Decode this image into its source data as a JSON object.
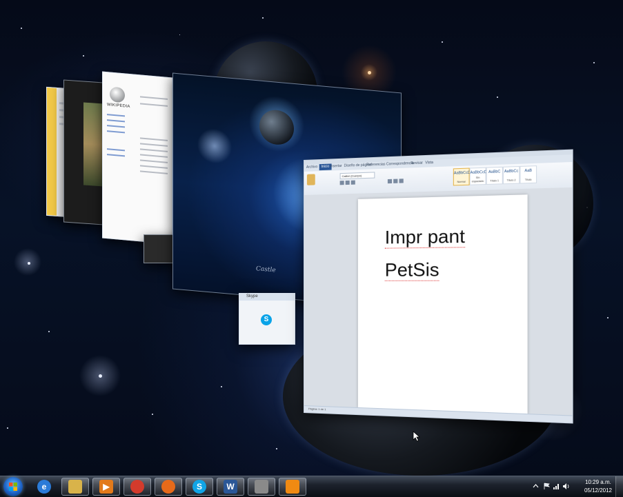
{
  "document": {
    "lines": [
      "Impr pant",
      "PetSis"
    ],
    "font_name": "Calibri (Cuerpo)",
    "tabs": [
      "Archivo",
      "Inicio",
      "Insertar",
      "Diseño de página",
      "Referencias",
      "Correspondencia",
      "Revisar",
      "Vista"
    ],
    "styles": [
      {
        "preview": "AaBbCcDc",
        "name": "Normal"
      },
      {
        "preview": "AaBbCcDc",
        "name": "Sin espaciado"
      },
      {
        "preview": "AaBbC",
        "name": "Título 1"
      },
      {
        "preview": "AaBbCc",
        "name": "Título 2"
      },
      {
        "preview": "AaB",
        "name": "Título"
      }
    ],
    "status": "Página: 1 de 1"
  },
  "wiki": {
    "title": "WIKIPEDIA"
  },
  "wallpaper": {
    "signature": "Castle"
  },
  "skype": {
    "title": "Skype"
  },
  "taskbar": {
    "items": [
      {
        "name": "internet-explorer",
        "glyph": "e",
        "color": "#2b7bd8",
        "active": false
      },
      {
        "name": "file-explorer",
        "glyph": "",
        "color": "#d9b34a",
        "active": true
      },
      {
        "name": "media-player",
        "glyph": "▶",
        "color": "#e27a1b",
        "active": true
      },
      {
        "name": "chrome",
        "glyph": "",
        "color": "#d33b2c",
        "active": true
      },
      {
        "name": "firefox",
        "glyph": "",
        "color": "#e66a1a",
        "active": true
      },
      {
        "name": "skype",
        "glyph": "S",
        "color": "#11a5e6",
        "active": true
      },
      {
        "name": "word",
        "glyph": "W",
        "color": "#2b5797",
        "active": true
      },
      {
        "name": "tool",
        "glyph": "",
        "color": "#8a8a8a",
        "active": true
      },
      {
        "name": "vlc",
        "glyph": "",
        "color": "#f08a12",
        "active": true
      }
    ]
  },
  "clock": {
    "time": "10:29 a.m.",
    "date": "05/12/2012"
  }
}
